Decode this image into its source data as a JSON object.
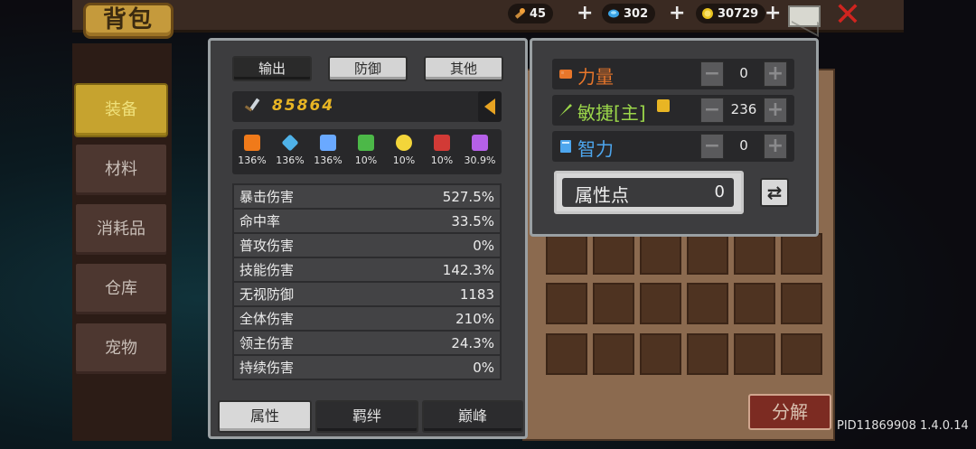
{
  "header": {
    "title": "背包",
    "resources": [
      {
        "icon": "fire-stick-icon",
        "value": "45"
      },
      {
        "icon": "blue-gem-icon",
        "value": "302"
      },
      {
        "icon": "gold-coin-icon",
        "value": "30729"
      }
    ],
    "plus": "+",
    "close": "✕"
  },
  "sidebar": {
    "items": [
      {
        "label": "装备",
        "active": true
      },
      {
        "label": "材料"
      },
      {
        "label": "消耗品"
      },
      {
        "label": "仓库"
      },
      {
        "label": "宠物"
      }
    ]
  },
  "attributes": {
    "tabs": [
      "输出",
      "防御",
      "其他"
    ],
    "active_tab": "输出",
    "power": "85864",
    "elements": [
      {
        "icon": "fire-icon",
        "value": "136%",
        "color": "#f07a1a"
      },
      {
        "icon": "ice-crystal-icon",
        "value": "136%",
        "color": "#4fb2e8"
      },
      {
        "icon": "lightning-icon",
        "value": "136%",
        "color": "#6aa9ff"
      },
      {
        "icon": "poison-skull-icon",
        "value": "10%",
        "color": "#4cb848"
      },
      {
        "icon": "sun-icon",
        "value": "10%",
        "color": "#f3d53a"
      },
      {
        "icon": "dark-moon-icon",
        "value": "10%",
        "color": "#d23a36"
      },
      {
        "icon": "purple-star-icon",
        "value": "30.9%",
        "color": "#b560e8"
      }
    ],
    "stats": [
      {
        "name": "暴击伤害",
        "value": "527.5%"
      },
      {
        "name": "命中率",
        "value": "33.5%"
      },
      {
        "name": "普攻伤害",
        "value": "0%"
      },
      {
        "name": "技能伤害",
        "value": "142.3%"
      },
      {
        "name": "无视防御",
        "value": "1183"
      },
      {
        "name": "全体伤害",
        "value": "210%"
      },
      {
        "name": "领主伤害",
        "value": "24.3%"
      },
      {
        "name": "持续伤害",
        "value": "0%"
      }
    ],
    "bottom_tabs": [
      "属性",
      "羁绊",
      "巅峰"
    ]
  },
  "points": {
    "rows": [
      {
        "label": "力量",
        "value": "0",
        "color": "#e8762a"
      },
      {
        "label": "敏捷[主]",
        "value": "236",
        "color": "#9bd64a"
      },
      {
        "label": "智力",
        "value": "0",
        "color": "#4da6ee"
      }
    ],
    "minus": "−",
    "plus": "+",
    "attr_points_label": "属性点",
    "attr_points_value": "0",
    "refresh": "⇄"
  },
  "inventory": {
    "decompose_label": "分解"
  },
  "footer": {
    "pid": "PID11869908 1.4.0.14"
  }
}
